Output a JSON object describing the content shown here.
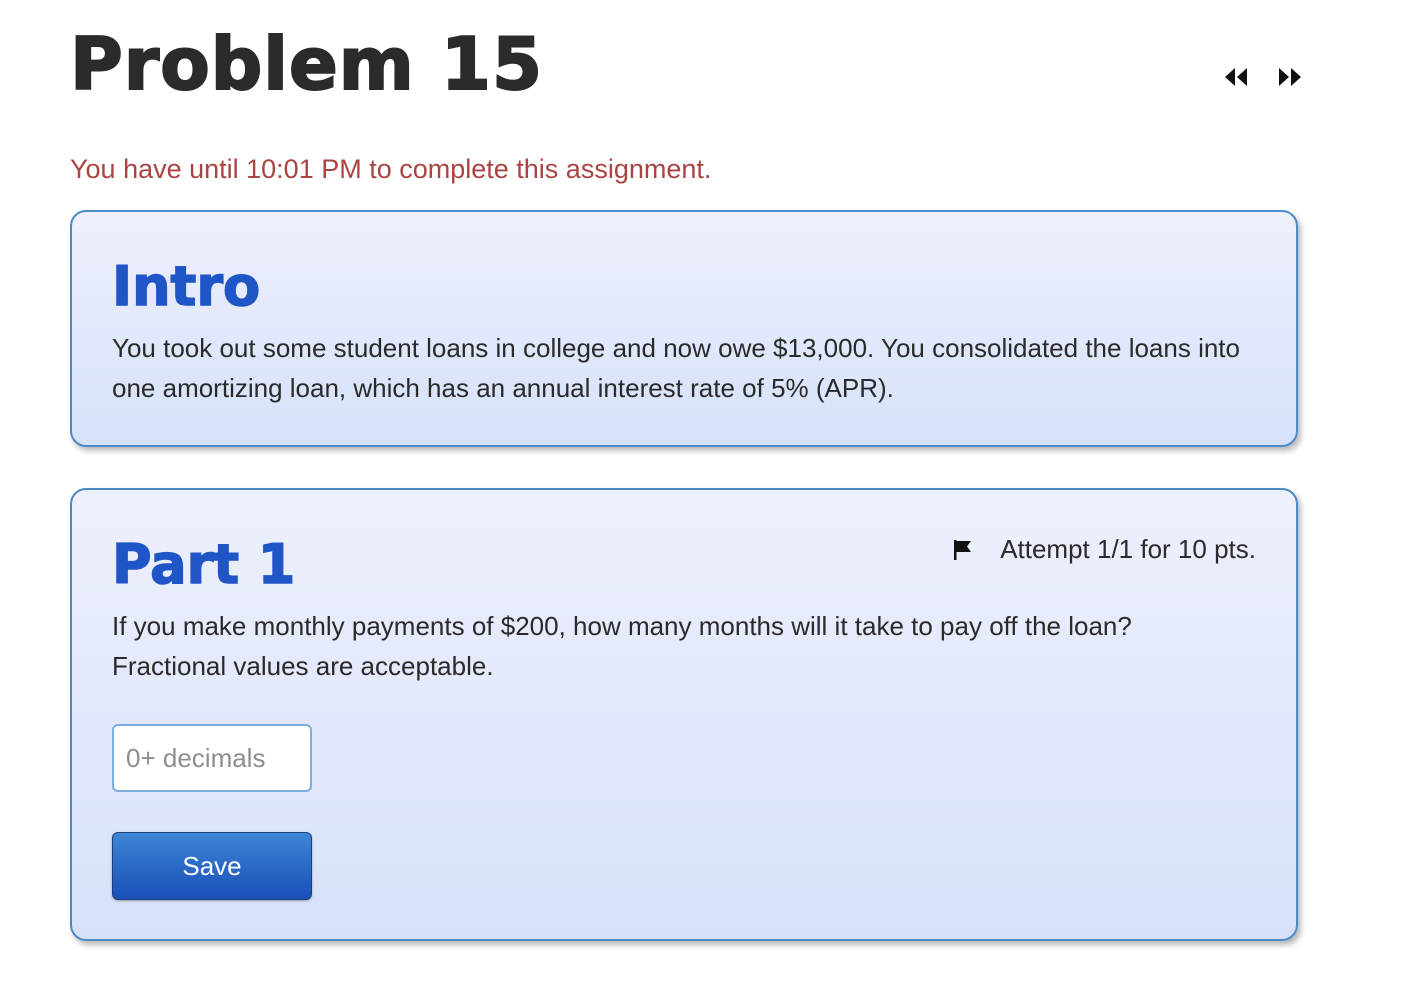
{
  "header": {
    "title": "Problem 15",
    "prev_icon": "double-chevron-left-icon",
    "next_icon": "double-chevron-right-icon"
  },
  "deadline_text": "You have until 10:01 PM to complete this assignment.",
  "intro": {
    "heading": "Intro",
    "text": "You took out some student loans in college and now owe $13,000. You consolidated the loans into one amortizing loan, which has an annual interest rate of 5% (APR)."
  },
  "part1": {
    "heading": "Part 1",
    "attempt_text": "Attempt 1/1 for 10 pts.",
    "flag_icon": "flag-icon",
    "question": "If you make monthly payments of $200, how many months will it take to pay off the loan? Fractional values are acceptable.",
    "input_placeholder": "0+ decimals",
    "input_value": "",
    "save_label": "Save"
  },
  "colors": {
    "title": "#2b2b2b",
    "deadline": "#a94442",
    "heading": "#1f55c7",
    "card_border": "#4a8bc6",
    "button": "#1a4fb8"
  }
}
